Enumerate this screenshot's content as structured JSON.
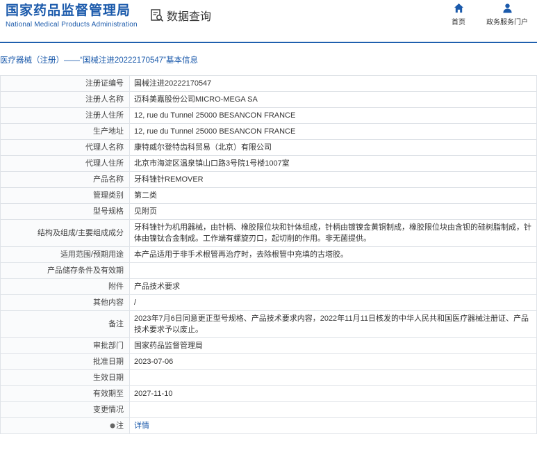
{
  "header": {
    "logo_cn": "国家药品监督管理局",
    "logo_en": "National Medical Products Administration",
    "query_title": "数据查询",
    "nav": [
      {
        "label": "首页",
        "icon": "home-icon"
      },
      {
        "label": "政务服务门户",
        "icon": "user-icon"
      }
    ]
  },
  "section_title": "医疗器械（注册）——“国械注进20222170547”基本信息",
  "rows": [
    {
      "label": "注册证编号",
      "value": "国械注进20222170547"
    },
    {
      "label": "注册人名称",
      "value": "迈科美嘉股份公司MICRO-MEGA SA"
    },
    {
      "label": "注册人住所",
      "value": "12, rue du Tunnel 25000 BESANCON FRANCE"
    },
    {
      "label": "生产地址",
      "value": "12, rue du Tunnel 25000 BESANCON FRANCE"
    },
    {
      "label": "代理人名称",
      "value": "康特威尔登特齿科贸易（北京）有限公司"
    },
    {
      "label": "代理人住所",
      "value": "北京市海淀区温泉镇山口路3号院1号楼1007室"
    },
    {
      "label": "产品名称",
      "value": "牙科锉针REMOVER"
    },
    {
      "label": "管理类别",
      "value": "第二类"
    },
    {
      "label": "型号规格",
      "value": "见附页"
    },
    {
      "label": "结构及组成/主要组成成分",
      "value": "牙科锉针为机用器械，由针柄、橡胶限位块和针体组成，针柄由镀镍金黄铜制成，橡胶限位块由含钡的硅树脂制成，针体由镍钛合金制成。工作端有螺旋刃口，起切削的作用。非无菌提供。"
    },
    {
      "label": "适用范围/预期用途",
      "value": "本产品适用于非手术根管再治疗时，去除根管中充填的古塔胶。"
    },
    {
      "label": "产品储存条件及有效期",
      "value": ""
    },
    {
      "label": "附件",
      "value": "产品技术要求"
    },
    {
      "label": "其他内容",
      "value": "/"
    },
    {
      "label": "备注",
      "value": "2023年7月6日同意更正型号规格、产品技术要求内容，2022年11月11日核发的中华人民共和国医疗器械注册证、产品技术要求予以废止。"
    },
    {
      "label": "审批部门",
      "value": "国家药品监督管理局"
    },
    {
      "label": "批准日期",
      "value": "2023-07-06"
    },
    {
      "label": "生效日期",
      "value": ""
    },
    {
      "label": "有效期至",
      "value": "2027-11-10"
    },
    {
      "label": "变更情况",
      "value": ""
    }
  ],
  "note_row": {
    "label": "注",
    "value": "详情"
  },
  "colors": {
    "brand": "#1b5aab",
    "border": "#dfe3e8"
  }
}
